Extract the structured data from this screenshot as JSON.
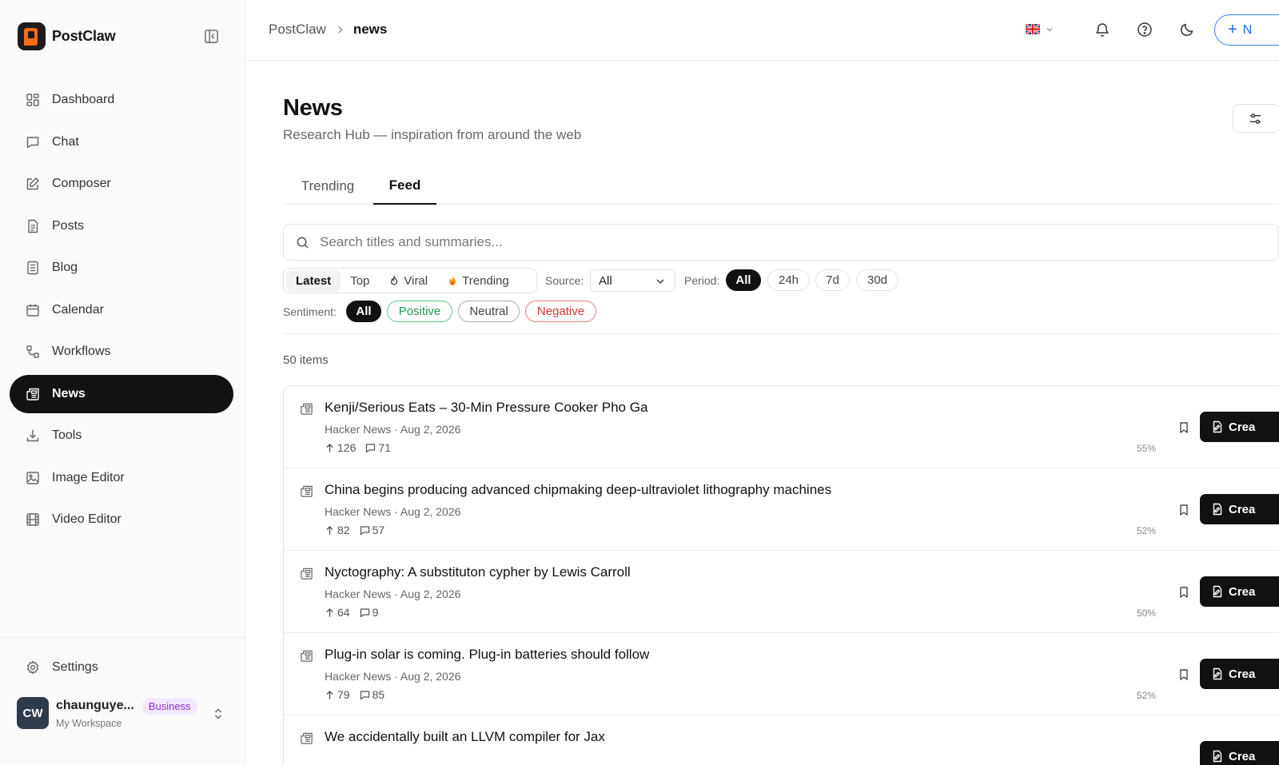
{
  "app": {
    "name": "PostClaw"
  },
  "sidebar": {
    "items": [
      {
        "label": "Dashboard",
        "icon": "dashboard-icon"
      },
      {
        "label": "Chat",
        "icon": "chat-icon"
      },
      {
        "label": "Composer",
        "icon": "compose-icon"
      },
      {
        "label": "Posts",
        "icon": "file-icon"
      },
      {
        "label": "Blog",
        "icon": "blog-icon"
      },
      {
        "label": "Calendar",
        "icon": "calendar-icon"
      },
      {
        "label": "Workflows",
        "icon": "workflow-icon"
      },
      {
        "label": "News",
        "icon": "newspaper-icon",
        "active": true
      },
      {
        "label": "Tools",
        "icon": "download-icon"
      },
      {
        "label": "Image Editor",
        "icon": "image-icon"
      },
      {
        "label": "Video Editor",
        "icon": "film-icon"
      }
    ],
    "settings_label": "Settings",
    "user": {
      "initials": "CW",
      "name": "chaunguye...",
      "plan": "Business",
      "workspace": "My Workspace"
    }
  },
  "topbar": {
    "breadcrumb": [
      "PostClaw",
      "news"
    ],
    "new_label": "N"
  },
  "page": {
    "title": "News",
    "subtitle": "Research Hub — inspiration from around the web",
    "tabs": [
      {
        "label": "Trending",
        "active": false
      },
      {
        "label": "Feed",
        "active": true
      }
    ]
  },
  "search": {
    "placeholder": "Search titles and summaries..."
  },
  "filters": {
    "sort_options": [
      {
        "label": "Latest",
        "active": true
      },
      {
        "label": "Top",
        "active": false
      },
      {
        "label": "Viral",
        "active": false
      },
      {
        "label": "Trending",
        "active": false
      }
    ],
    "source_label": "Source:",
    "source_value": "All",
    "period_label": "Period:",
    "periods": [
      "All",
      "24h",
      "7d",
      "30d"
    ],
    "period_selected": "All",
    "sentiment_label": "Sentiment:",
    "sentiments": [
      "All",
      "Positive",
      "Neutral",
      "Negative"
    ],
    "sentiment_selected": "All"
  },
  "feed": {
    "count_label": "50 items",
    "items": [
      {
        "title": "Kenji/Serious Eats – 30-Min Pressure Cooker Pho Ga",
        "meta": "Hacker News · Aug 2, 2026",
        "upvotes": "126",
        "comments": "71",
        "score": "55%"
      },
      {
        "title": "China begins producing advanced chipmaking deep-ultraviolet lithography machines",
        "meta": "Hacker News · Aug 2, 2026",
        "upvotes": "82",
        "comments": "57",
        "score": "52%"
      },
      {
        "title": "Nyctography: A substituton cypher by Lewis Carroll",
        "meta": "Hacker News · Aug 2, 2026",
        "upvotes": "64",
        "comments": "9",
        "score": "50%"
      },
      {
        "title": "Plug-in solar is coming. Plug-in batteries should follow",
        "meta": "Hacker News · Aug 2, 2026",
        "upvotes": "79",
        "comments": "85",
        "score": "52%"
      },
      {
        "title": "We accidentally built an LLVM compiler for Jax",
        "meta": "",
        "upvotes": "",
        "comments": "",
        "score": ""
      }
    ],
    "create_label": "Crea"
  },
  "colors": {
    "accent_blue": "#2563eb",
    "brand_orange": "#f36b1c",
    "positive": "#1e9a52",
    "negative": "#d83232",
    "business_badge": "#8b2fc9"
  }
}
